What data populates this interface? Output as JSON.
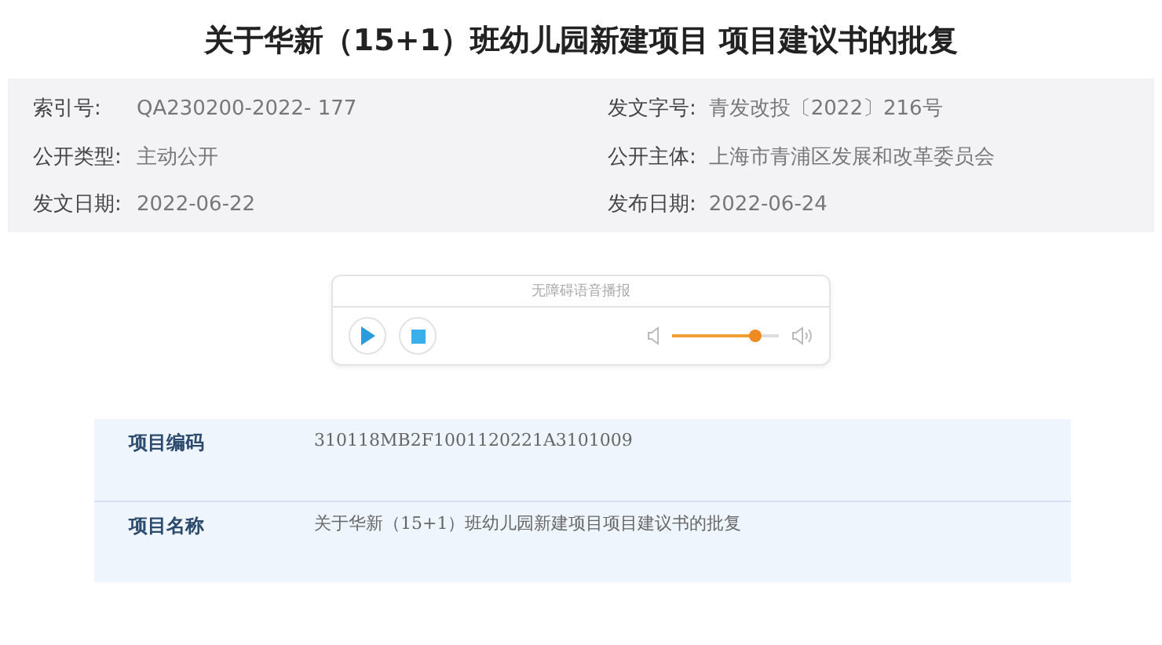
{
  "title": "关于华新（15+1）班幼儿园新建项目 项目建议书的批复",
  "meta": [
    {
      "label": "索引号:",
      "value": "QA230200-2022- 177"
    },
    {
      "label": "发文字号:",
      "value": "青发改投〔2022〕216号"
    },
    {
      "label": "公开类型:",
      "value": "主动公开"
    },
    {
      "label": "公开主体:",
      "value": "上海市青浦区发展和改革委员会"
    },
    {
      "label": "发文日期:",
      "value": "2022-06-22"
    },
    {
      "label": "发布日期:",
      "value": "2022-06-24"
    }
  ],
  "player": {
    "caption": "无障碍语音播报"
  },
  "table": {
    "rows": [
      {
        "label": "项目编码",
        "value": "310118MB2F1001120221A3101009"
      },
      {
        "label": "项目名称",
        "value": "关于华新（15+1）班幼儿园新建项目项目建议书的批复"
      }
    ]
  }
}
